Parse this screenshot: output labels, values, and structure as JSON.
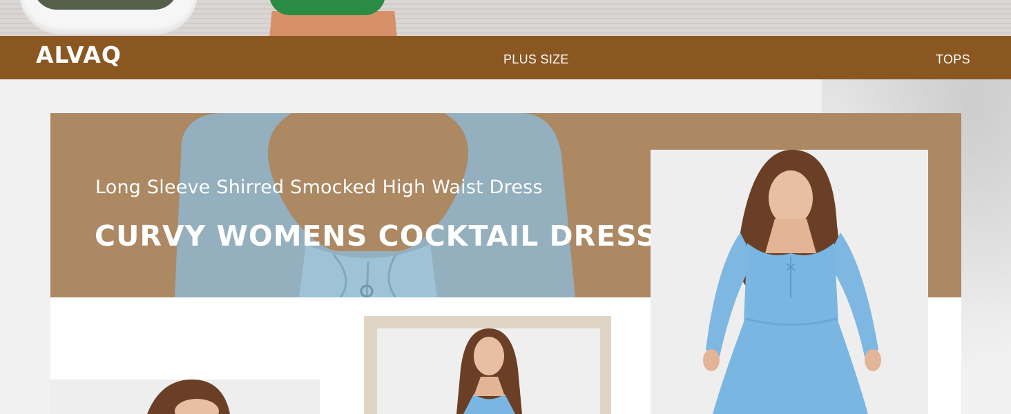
{
  "brand": {
    "logo_text": "ALVAQ"
  },
  "nav": {
    "items": [
      {
        "label": "PLUS SIZE"
      },
      {
        "label": "TOPS"
      }
    ]
  },
  "banner": {
    "subtitle": "Long Sleeve Shirred Smocked High Waist Dress",
    "title": "CURVY WOMENS COCKTAIL DRESS"
  },
  "colors": {
    "nav_bg": "#8b5721",
    "banner_bg": "#ac8863",
    "dress_blue": "#79b6e2",
    "frame_beige": "#e0d5c5"
  }
}
